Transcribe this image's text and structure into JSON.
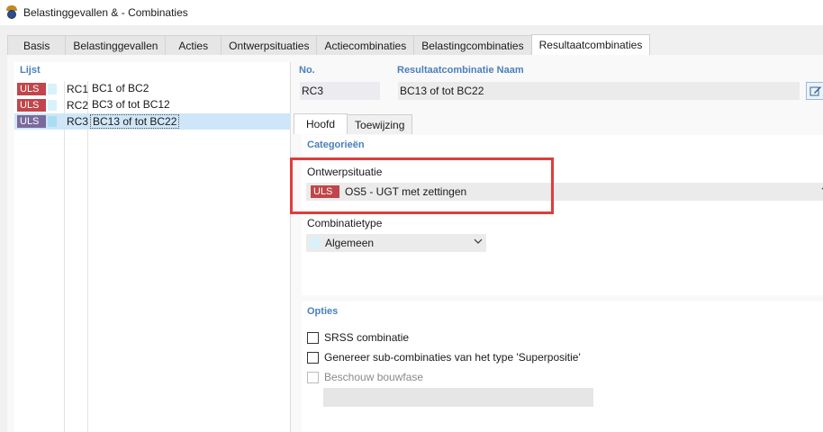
{
  "window": {
    "title": "Belastinggevallen & - Combinaties",
    "app_icon": "rfem-app-icon"
  },
  "tabs": [
    "Basis",
    "Belastinggevallen",
    "Acties",
    "Ontwerpsituaties",
    "Actiecombinaties",
    "Belastingcombinaties",
    "Resultaatcombinaties"
  ],
  "active_tab": "Resultaatcombinaties",
  "list": {
    "title": "Lijst",
    "rows": [
      {
        "badge": "ULS",
        "id": "RC1",
        "name": "BC1 of BC2",
        "color": "#d7f2fa"
      },
      {
        "badge": "ULS",
        "id": "RC2",
        "name": "BC3 of tot BC12",
        "color": "#d7f2fa"
      },
      {
        "badge": "ULS",
        "id": "RC3",
        "name": "BC13 of tot BC22",
        "color": "#a9ddf2",
        "selected": true
      }
    ]
  },
  "header": {
    "no_label": "No.",
    "no_value": "RC3",
    "name_label": "Resultaatcombinatie Naam",
    "name_value": "BC13 of tot BC22",
    "edit_icon": "edit-name-icon"
  },
  "inner_tabs": [
    "Hoofd",
    "Toewijzing"
  ],
  "categories": {
    "title": "Categorieën",
    "design_situation_label": "Ontwerpsituatie",
    "design_situation_badge": "ULS",
    "design_situation_value": "OS5 - UGT met zettingen",
    "combination_type_label": "Combinatietype",
    "combination_type_value": "Algemeen"
  },
  "options": {
    "title": "Opties",
    "items": [
      {
        "label": "SRSS combinatie",
        "checked": false,
        "enabled": true
      },
      {
        "label": "Genereer sub-combinaties van het type 'Superpositie'",
        "checked": false,
        "enabled": true
      },
      {
        "label": "Beschouw bouwfase",
        "checked": false,
        "enabled": false
      }
    ]
  },
  "colors": {
    "accent": "#4a7fbb",
    "uls_badge": "#c0464a",
    "uls_badge_selected": "#7a6a9b",
    "highlight": "#e03c3c",
    "selection": "#cfe6f8"
  }
}
